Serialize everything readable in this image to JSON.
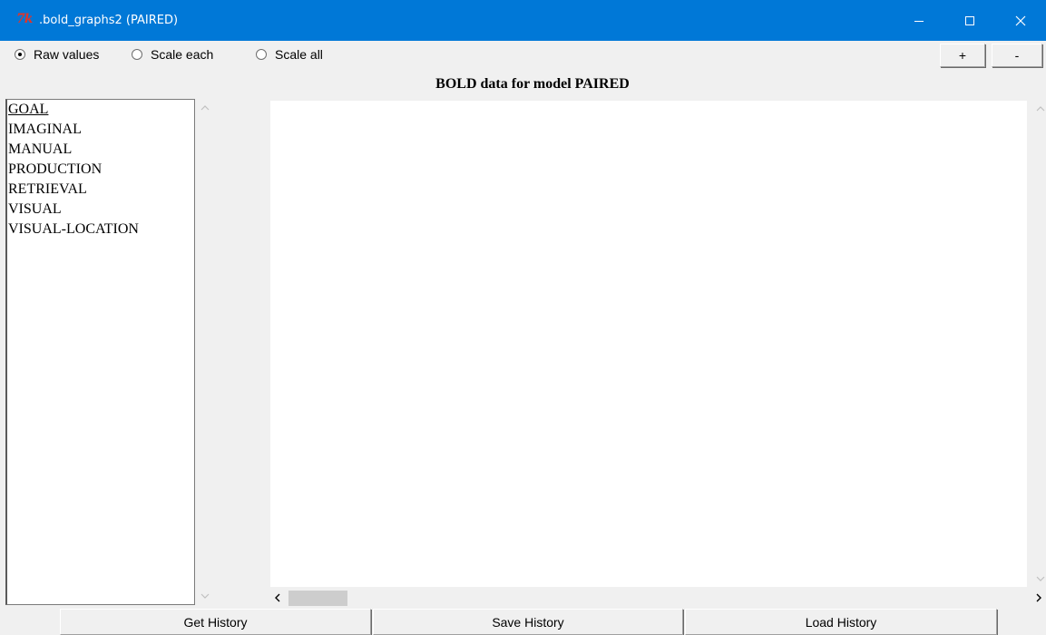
{
  "window": {
    "title": ".bold_graphs2 (PAIRED)",
    "app_icon_glyph": "7k",
    "titlebar_color": "#0078d7",
    "controls": {
      "minimize": "minimize-icon",
      "maximize": "maximize-icon",
      "close": "close-icon"
    }
  },
  "options": {
    "radios": [
      {
        "label": "Raw values",
        "checked": true
      },
      {
        "label": "Scale each",
        "checked": false
      },
      {
        "label": "Scale all",
        "checked": false
      }
    ],
    "zoom_in_label": "+",
    "zoom_out_label": "-"
  },
  "graph": {
    "title": "BOLD data for model PAIRED"
  },
  "buffers": {
    "items": [
      "GOAL",
      "IMAGINAL",
      "MANUAL",
      "PRODUCTION",
      "RETRIEVAL",
      "VISUAL",
      "VISUAL-LOCATION"
    ],
    "active": "GOAL"
  },
  "actions": {
    "get_history": "Get History",
    "save_history": "Save History",
    "load_history": "Load History"
  }
}
